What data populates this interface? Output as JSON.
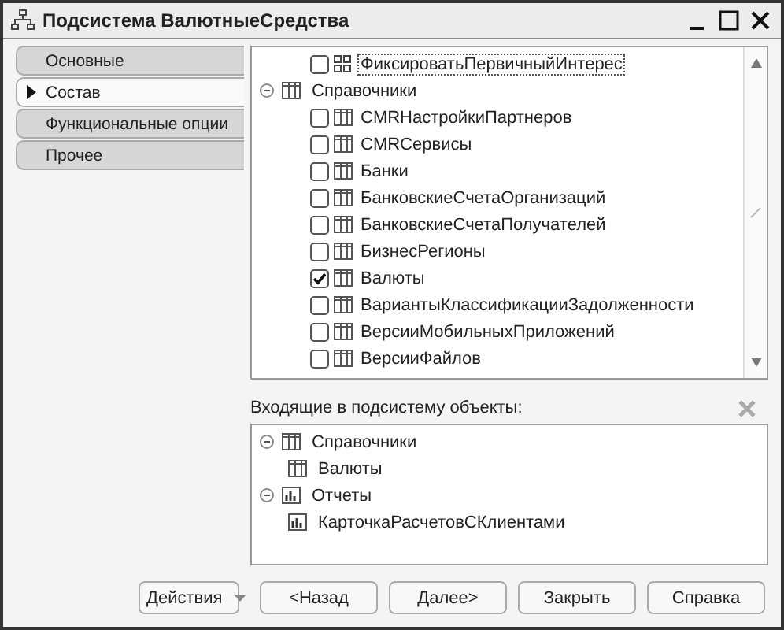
{
  "window": {
    "title": "Подсистема ВалютныеСредства"
  },
  "tabs": [
    {
      "label": "Основные",
      "selected": false
    },
    {
      "label": "Состав",
      "selected": true
    },
    {
      "label": "Функциональные опции",
      "selected": false
    },
    {
      "label": "Прочее",
      "selected": false
    }
  ],
  "tree": [
    {
      "kind": "continued",
      "children": [
        {
          "label": "ФиксироватьПервичныйИнтерес",
          "kind": "group",
          "checked": false,
          "selected": true
        }
      ]
    },
    {
      "kind": "catalog",
      "label": "Справочники",
      "expanded": true,
      "children": [
        {
          "label": "CMRНастройкиПартнеров",
          "kind": "catalog",
          "checked": false,
          "selected": false
        },
        {
          "label": "CMRСервисы",
          "kind": "catalog",
          "checked": false,
          "selected": false
        },
        {
          "label": "Банки",
          "kind": "catalog",
          "checked": false,
          "selected": false
        },
        {
          "label": "БанковскиеСчетаОрганизаций",
          "kind": "catalog",
          "checked": false,
          "selected": false
        },
        {
          "label": "БанковскиеСчетаПолучателей",
          "kind": "catalog",
          "checked": false,
          "selected": false
        },
        {
          "label": "БизнесРегионы",
          "kind": "catalog",
          "checked": false,
          "selected": false
        },
        {
          "label": "Валюты",
          "kind": "catalog",
          "checked": true,
          "selected": false
        },
        {
          "label": "ВариантыКлассификацииЗадолженности",
          "kind": "catalog",
          "checked": false,
          "selected": false
        },
        {
          "label": "ВерсииМобильныхПриложений",
          "kind": "catalog",
          "checked": false,
          "selected": false
        },
        {
          "label": "ВерсииФайлов",
          "kind": "catalog",
          "checked": false,
          "selected": false
        }
      ]
    }
  ],
  "included": {
    "label": "Входящие в подсистему объекты:",
    "tree": [
      {
        "label": "Справочники",
        "kind": "catalog",
        "expanded": true,
        "children": [
          {
            "label": "Валюты",
            "kind": "catalog"
          }
        ]
      },
      {
        "label": "Отчеты",
        "kind": "report",
        "expanded": true,
        "children": [
          {
            "label": "КарточкаРасчетовСКлиентами",
            "kind": "report"
          }
        ]
      }
    ]
  },
  "buttons": [
    {
      "label": "Действия",
      "kind": "menu"
    },
    {
      "label": "<Назад",
      "kind": "plain"
    },
    {
      "label": "Далее>",
      "kind": "plain"
    },
    {
      "label": "Закрыть",
      "kind": "plain"
    },
    {
      "label": "Справка",
      "kind": "plain"
    }
  ]
}
